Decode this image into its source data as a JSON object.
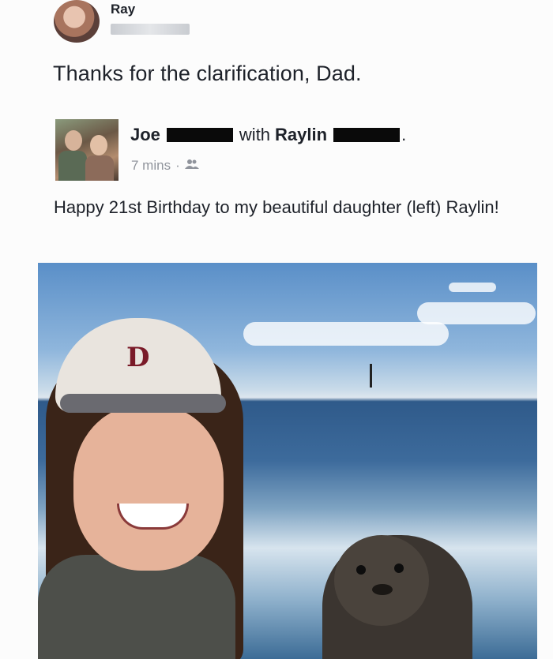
{
  "comment": {
    "author": "Ray",
    "text": "Thanks for the clarification, Dad."
  },
  "post": {
    "author": "Joe",
    "with_label": "with",
    "tagged": "Raylin",
    "timestamp": "7 mins",
    "separator": "·",
    "audience_icon": "friends-icon",
    "text": "Happy 21st Birthday to my beautiful daughter (left) Raylin!",
    "photo_caption_icon": "photo-icon"
  }
}
